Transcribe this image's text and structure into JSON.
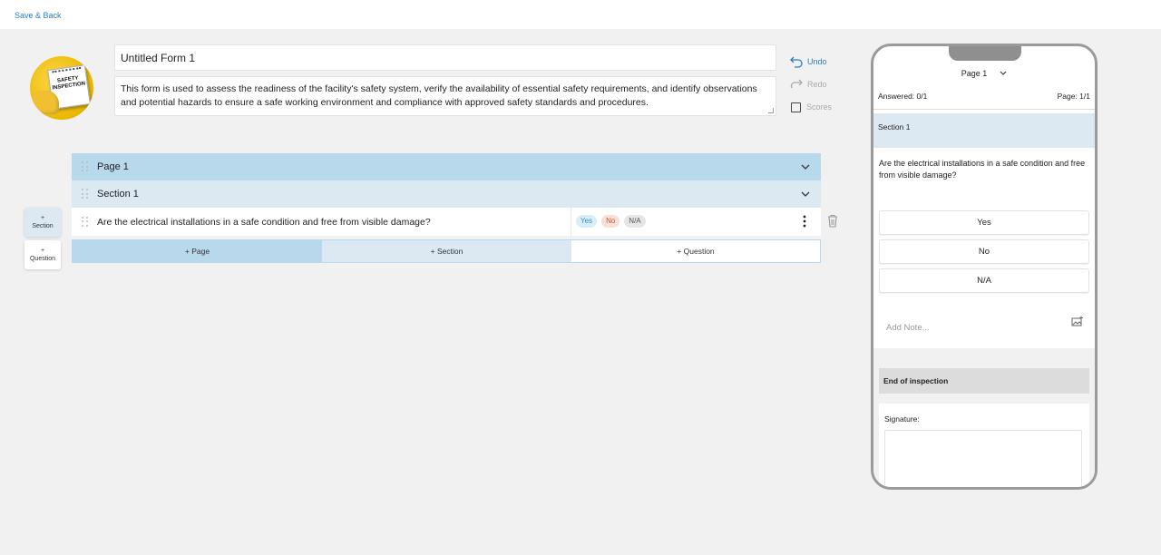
{
  "topbar": {
    "back_label": "Save & Back"
  },
  "form": {
    "title": "Untitled Form 1",
    "description": "This form is used to assess the readiness of the facility's safety system, verify the availability of essential safety requirements, and identify observations and potential hazards to ensure a safe working environment and compliance with approved safety standards and procedures.",
    "logo_text": "SAFETY INSPECTION"
  },
  "actions": {
    "undo": "Undo",
    "redo": "Redo",
    "scores": "Scores"
  },
  "builder": {
    "page_label": "Page 1",
    "section_label": "Section 1",
    "question_text": "Are the electrical installations in a safe condition and free from visible damage?",
    "chips": {
      "yes": "Yes",
      "no": "No",
      "na": "N/A"
    },
    "add_page": "+ Page",
    "add_section": "+ Section",
    "add_question": "+ Question"
  },
  "floating": {
    "section_plus": "+",
    "section_label": "Section",
    "question_plus": "+",
    "question_label": "Question"
  },
  "preview": {
    "page_selector": "Page 1",
    "answered": "Answered: 0/1",
    "page_count": "Page: 1/1",
    "section_title": "Section 1",
    "question": "Are the electrical installations in a safe condition and free from visible damage?",
    "options": [
      "Yes",
      "No",
      "N/A"
    ],
    "note_placeholder": "Add Note...",
    "end_label": "End of inspection",
    "signature_label": "Signature:"
  },
  "colors": {
    "accent": "#2a7dc0",
    "page_row": "#b8d8ec",
    "section_row": "#dce9f3",
    "background": "#f1f1f1"
  },
  "icons": [
    "undo-icon",
    "redo-icon",
    "drag-handle-icon",
    "chevron-down-icon",
    "kebab-menu-icon",
    "trash-icon",
    "add-image-icon"
  ]
}
